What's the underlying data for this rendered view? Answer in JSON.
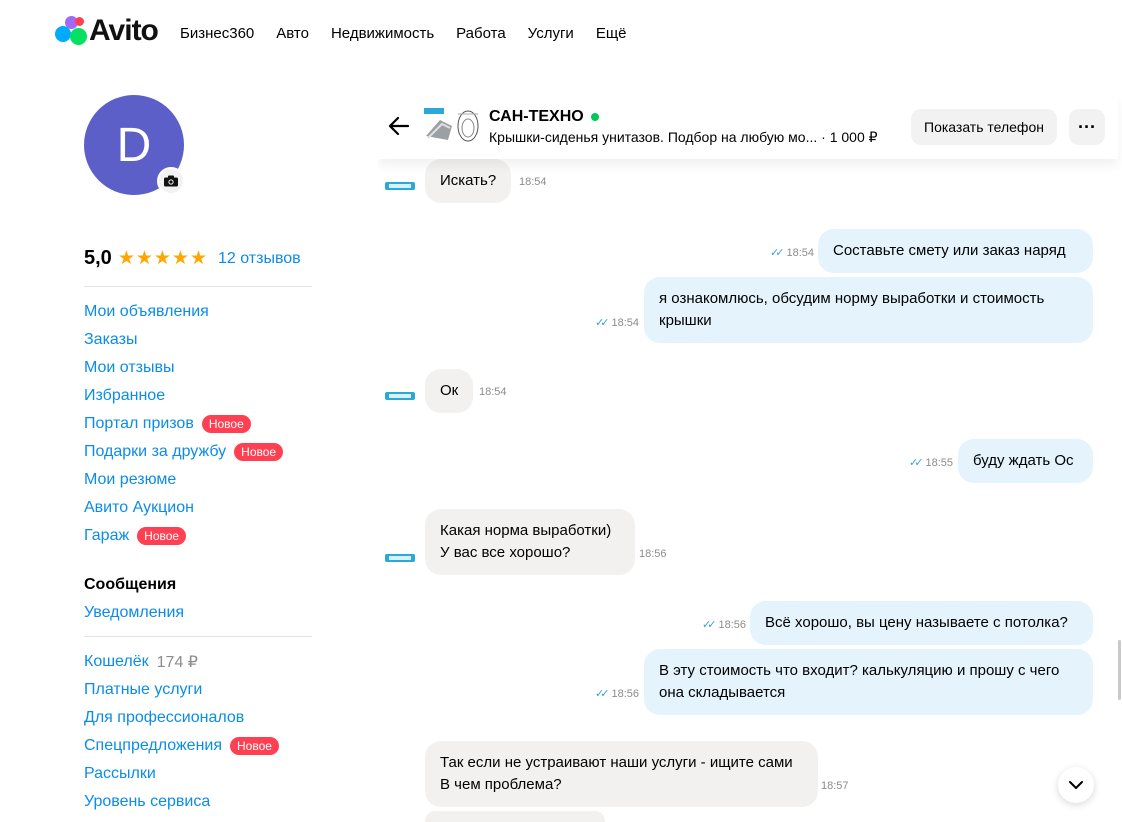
{
  "logo": {
    "text": "Avito"
  },
  "nav": [
    "Бизнес360",
    "Авто",
    "Недвижимость",
    "Работа",
    "Услуги",
    "Ещё"
  ],
  "profile": {
    "avatar_letter": "D",
    "rating": "5,0",
    "stars": "★★★★★",
    "reviews": "12 отзывов"
  },
  "menu1": [
    {
      "label": "Мои объявления",
      "badge": ""
    },
    {
      "label": "Заказы",
      "badge": ""
    },
    {
      "label": "Мои отзывы",
      "badge": ""
    },
    {
      "label": "Избранное",
      "badge": ""
    },
    {
      "label": "Портал призов",
      "badge": "Новое"
    },
    {
      "label": "Подарки за дружбу",
      "badge": "Новое"
    },
    {
      "label": "Мои резюме",
      "badge": ""
    },
    {
      "label": "Авито Аукцион",
      "badge": ""
    },
    {
      "label": "Гараж",
      "badge": "Новое"
    }
  ],
  "menu2": {
    "messages": "Сообщения",
    "notifications": "Уведомления"
  },
  "menu3": {
    "wallet": "Кошелёк",
    "wallet_amount": "174 ₽",
    "paid": "Платные услуги",
    "pro": "Для профессионалов",
    "special": "Спецпредложения",
    "special_badge": "Новое",
    "mailings": "Рассылки",
    "service": "Уровень сервиса"
  },
  "chat": {
    "seller": "САН-ТЕХНО",
    "ad_title": "Крышки-сиденья унитазов. Подбор на любую мо...",
    "ad_price": "· 1 000 ₽",
    "phone_button": "Показать телефон",
    "more_button": "···",
    "messages": [
      {
        "dir": "in",
        "lines": [
          "Искать?"
        ],
        "time": "18:54"
      },
      {
        "dir": "out",
        "lines": [
          "Составьте смету или заказ наряд"
        ],
        "time": "18:54"
      },
      {
        "dir": "out",
        "lines": [
          "я ознакомлюсь, обсудим норму выработки и стоимость",
          "крышки"
        ],
        "time": "18:54"
      },
      {
        "dir": "in",
        "lines": [
          "Ок"
        ],
        "time": "18:54"
      },
      {
        "dir": "out",
        "lines": [
          "буду ждать Ос"
        ],
        "time": "18:55"
      },
      {
        "dir": "in",
        "lines": [
          "Какая норма выработки)",
          "У вас все хорошо?"
        ],
        "time": "18:56"
      },
      {
        "dir": "out",
        "lines": [
          "Всё хорошо, вы цену называете с потолка?"
        ],
        "time": "18:56"
      },
      {
        "dir": "out",
        "lines": [
          "В эту стоимость что входит? калькуляцию и прошу с чего",
          "она складывается"
        ],
        "time": "18:56"
      },
      {
        "dir": "in",
        "lines": [
          "Так если не устраивают наши услуги - ищите сами",
          "В чем проблема?"
        ],
        "time": "18:57"
      }
    ]
  }
}
